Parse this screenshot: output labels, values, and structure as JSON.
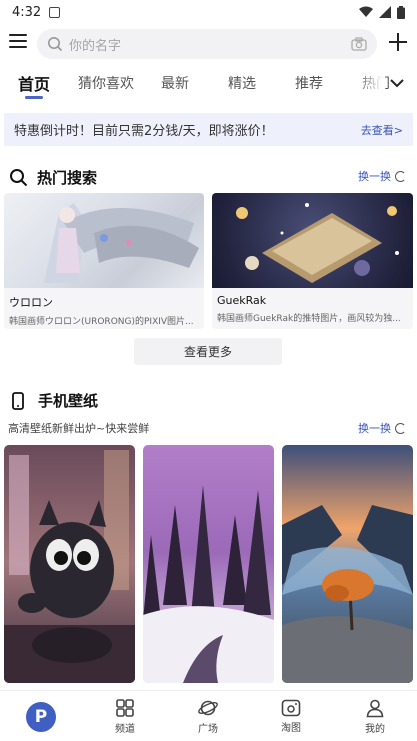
{
  "status_bar": {
    "time": "4:32"
  },
  "search": {
    "placeholder": "你的名字"
  },
  "tabs": [
    {
      "label": "首页",
      "active": true
    },
    {
      "label": "猜你喜欢"
    },
    {
      "label": "最新"
    },
    {
      "label": "精选"
    },
    {
      "label": "推荐"
    },
    {
      "label": "热门"
    }
  ],
  "promo": {
    "text": "特惠倒计时！目前只需2分钱/天，即将涨价！",
    "link": "去查看>"
  },
  "hot_search": {
    "title": "热门搜索",
    "refresh": "换一换",
    "cards": [
      {
        "name": "ウロロン",
        "desc": "韩国画师ウロロン(URORONG)的PIXIV图片..."
      },
      {
        "name": "GuekRak",
        "desc": "韩国画师GuekRak的推特图片，画风较为独..."
      }
    ],
    "more": "查看更多"
  },
  "wallpaper": {
    "title": "手机壁纸",
    "subtitle": "高清壁纸新鲜出炉~快来尝鲜",
    "refresh": "换一换"
  },
  "bottom_nav": [
    {
      "label": "",
      "icon": "p-logo-icon"
    },
    {
      "label": "频道",
      "icon": "grid-icon"
    },
    {
      "label": "广场",
      "icon": "planet-icon"
    },
    {
      "label": "淘图",
      "icon": "photo-icon"
    },
    {
      "label": "我的",
      "icon": "user-icon"
    }
  ],
  "colors": {
    "accent": "#4a66c9",
    "link": "#3a56b8",
    "promo_bg": "#eef0fb"
  }
}
